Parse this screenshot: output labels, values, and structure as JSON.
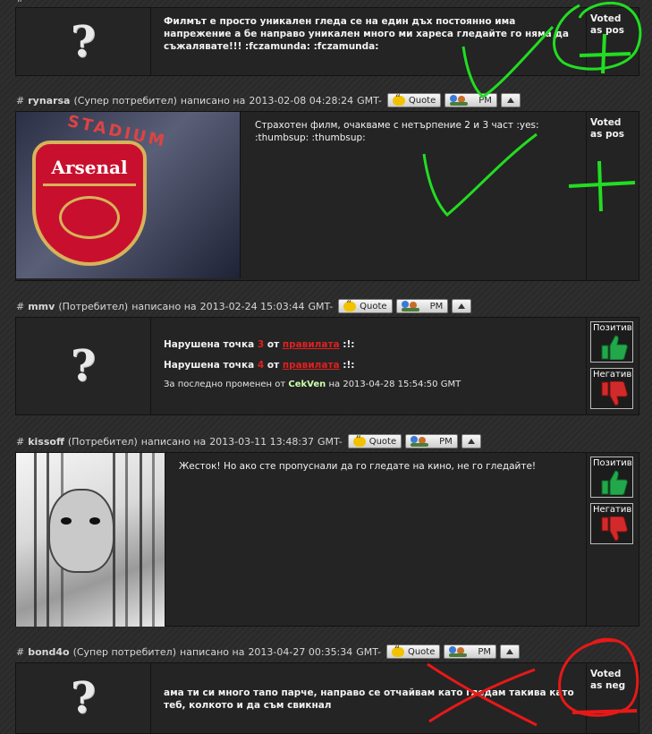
{
  "posts": [
    {
      "user": "",
      "rank": "",
      "written": "",
      "date": "",
      "text": "Филмът е просто уникален гледа се на един дъх постоянно има напрежение а бе направо уникален много ми хареса гледайте го няма да съжалявате!!! :fczamunda: :fczamunda:",
      "vote_text": "Voted as pos"
    },
    {
      "user": "rynarsa",
      "rank": "(Супер потребител)",
      "written": "написано на",
      "date": "2013-02-08 04:28:24",
      "tz": "GMT-",
      "text": "Страхотен филм, очакваме с нетърпение 2 и 3 част :yes: :thumbsup: :thumbsup:",
      "vote_text": "Voted as pos"
    },
    {
      "user": "mmv",
      "rank": "(Потребител)",
      "written": "написано на",
      "date": "2013-02-24 15:03:44",
      "tz": "GMT-",
      "violation_label": "Нарушена точка",
      "point1": "3",
      "point2": "4",
      "from": "от",
      "rules_link": "правилата",
      "rules_suffix": ":!:",
      "edit_prefix": "За последно променен от",
      "editor": "CekVen",
      "edit_on": "на",
      "edit_date": "2013-04-28 15:54:50 GMT",
      "positive": "Позитивн",
      "negative": "Негативн"
    },
    {
      "user": "kissoff",
      "rank": "(Потребител)",
      "written": "написано на",
      "date": "2013-03-11 13:48:37",
      "tz": "GMT-",
      "text": "Жесток! Но ако сте пропуснали да го гледате на кино, не го гледайте!",
      "positive": "Позитивн",
      "negative": "Негативн"
    },
    {
      "user": "bond4o",
      "rank": "(Супер потребител)",
      "written": "написано на",
      "date": "2013-04-27 00:35:34",
      "tz": "GMT-",
      "text": "ама ти си много тапо парче, направо се отчайвам като гледам такива като теб, колкото и да съм свикнал",
      "vote_text": "Voted as neg"
    }
  ],
  "buttons": {
    "quote": "Quote",
    "pm": "PM"
  },
  "hash": "#",
  "arsenal": {
    "stadium": "STADIUM",
    "club": "Arsenal"
  },
  "colors": {
    "annotation_green": "#22dd22",
    "annotation_red": "#e81818",
    "thumb_up": "#22a84a",
    "thumb_down": "#d22a2a"
  }
}
